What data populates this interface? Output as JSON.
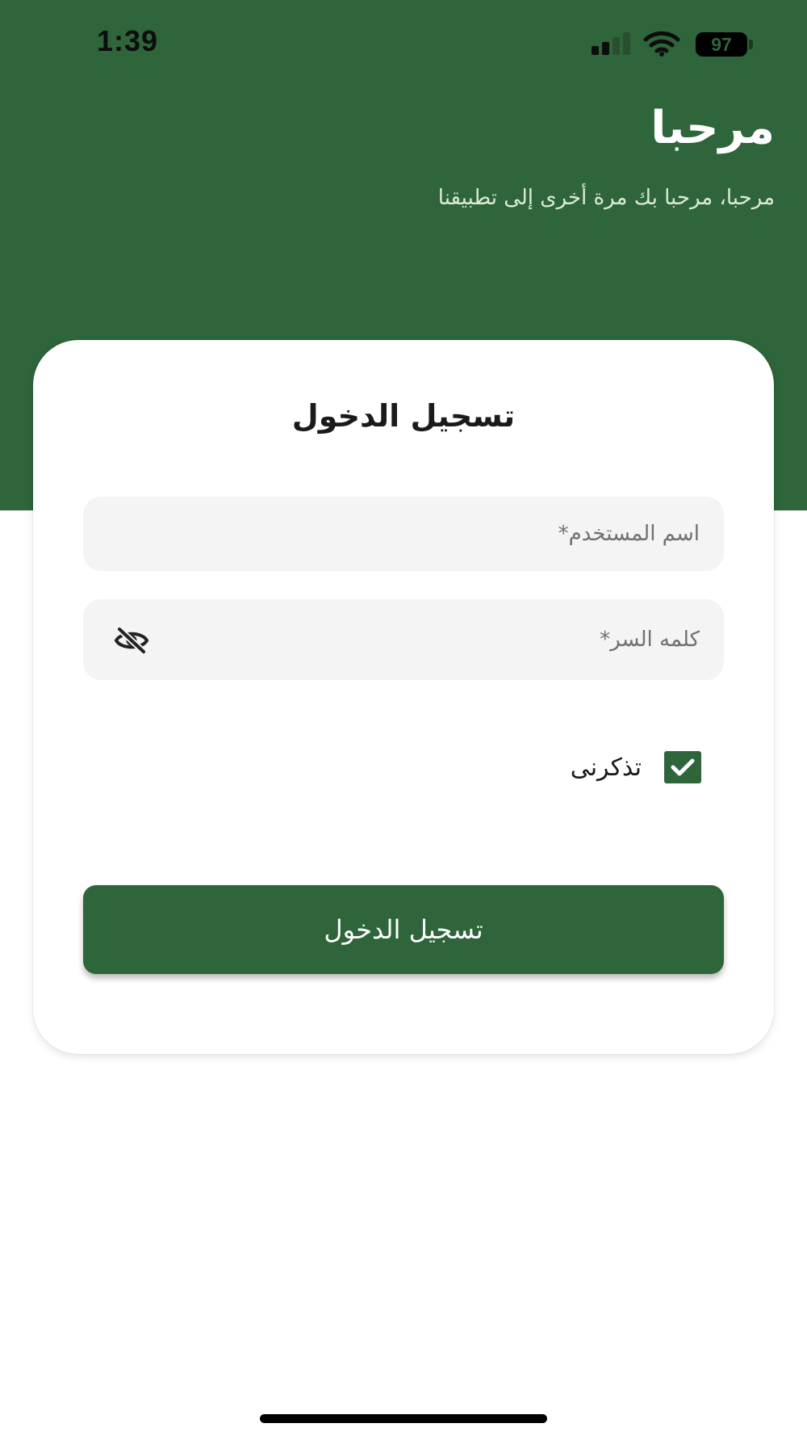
{
  "status_bar": {
    "time": "1:39",
    "battery_level": "97",
    "icons": [
      "cellular-signal-icon",
      "wifi-icon",
      "battery-icon"
    ]
  },
  "header": {
    "title": "مرحبا",
    "subtitle": "مرحبا، مرحبا بك مرة أخرى إلى تطبيقنا"
  },
  "login_card": {
    "title": "تسجيل الدخول",
    "username_placeholder": "اسم المستخدم*",
    "password_placeholder": "كلمه السر*",
    "password_visibility_icon": "eye-off-icon",
    "remember_me_label": "تذكرنى",
    "remember_me_checked": true,
    "submit_label": "تسجيل الدخول"
  },
  "colors": {
    "primary": "#2e653b",
    "field_background": "#f4f4f4",
    "card_background": "#ffffff"
  }
}
